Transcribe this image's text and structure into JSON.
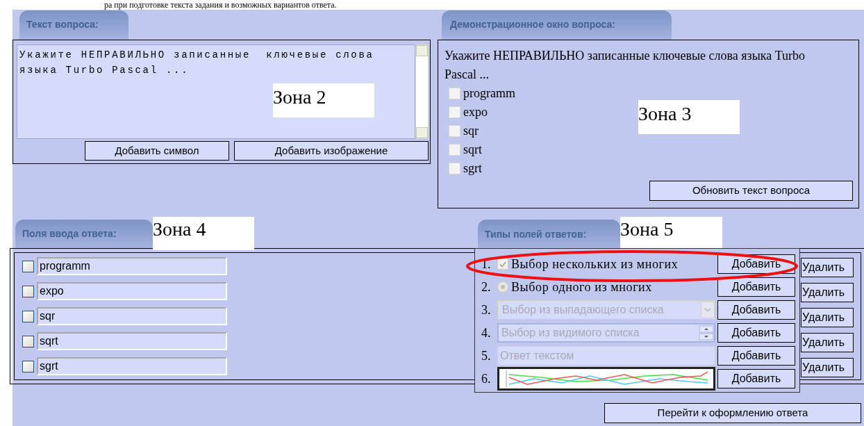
{
  "document_text": "ра при подготовке текста задания и возможных вариантов ответа.",
  "question_panel": {
    "tab": "Текст вопроса:",
    "text": "Укажите НЕПРАВИЛЬНО записанные  ключевые слова языка Turbo Pascal ...",
    "zone_label": "Зона 2",
    "buttons": [
      "Добавить символ",
      "Добавить изображение"
    ]
  },
  "demo_panel": {
    "tab": "Демонстрационное окно вопроса:",
    "question": "Укажите НЕПРАВИЛЬНО записанные ключевые слова языка Turbo Pascal ...",
    "zone_label": "Зона 3",
    "options": [
      {
        "label": "programm",
        "checked": false
      },
      {
        "label": "expo",
        "checked": false
      },
      {
        "label": "sqr",
        "checked": false
      },
      {
        "label": "sqrt",
        "checked": false
      },
      {
        "label": "sgrt",
        "checked": false
      }
    ],
    "button": "Обновить текст вопроса"
  },
  "answer_fields_panel": {
    "tab": "Поля ввода ответа:",
    "zone_label": "Зона 4",
    "fields": [
      {
        "value": "programm",
        "checked": false,
        "delete_button": "Удалить"
      },
      {
        "value": "expo",
        "checked": false,
        "delete_button": "Удалить"
      },
      {
        "value": "sqr",
        "checked": false,
        "delete_button": "Удалить"
      },
      {
        "value": "sqrt",
        "checked": false,
        "delete_button": "Удалить"
      },
      {
        "value": "sgrt",
        "checked": false,
        "delete_button": "Удалить"
      }
    ]
  },
  "field_types_panel": {
    "tab": "Типы полей ответов:",
    "zone_label": "Зона 5",
    "types": [
      {
        "number": "1.",
        "kind": "checkbox",
        "label": "Выбор нескольких из многих",
        "checked": true,
        "add_button": "Добавить"
      },
      {
        "number": "2.",
        "kind": "radio",
        "label": "Выбор одного из многих",
        "checked": true,
        "add_button": "Добавить"
      },
      {
        "number": "3.",
        "kind": "dropdown",
        "placeholder": "Выбор из выпадающего списка",
        "add_button": "Добавить"
      },
      {
        "number": "4.",
        "kind": "listbox",
        "placeholder": "Выбор из видимого списка",
        "add_button": "Добавить"
      },
      {
        "number": "5.",
        "kind": "text",
        "placeholder": "Ответ текстом",
        "add_button": "Добавить"
      },
      {
        "number": "6.",
        "kind": "chart",
        "add_button": "Добавить"
      }
    ]
  },
  "footer_button": "Перейти к оформлению ответа"
}
